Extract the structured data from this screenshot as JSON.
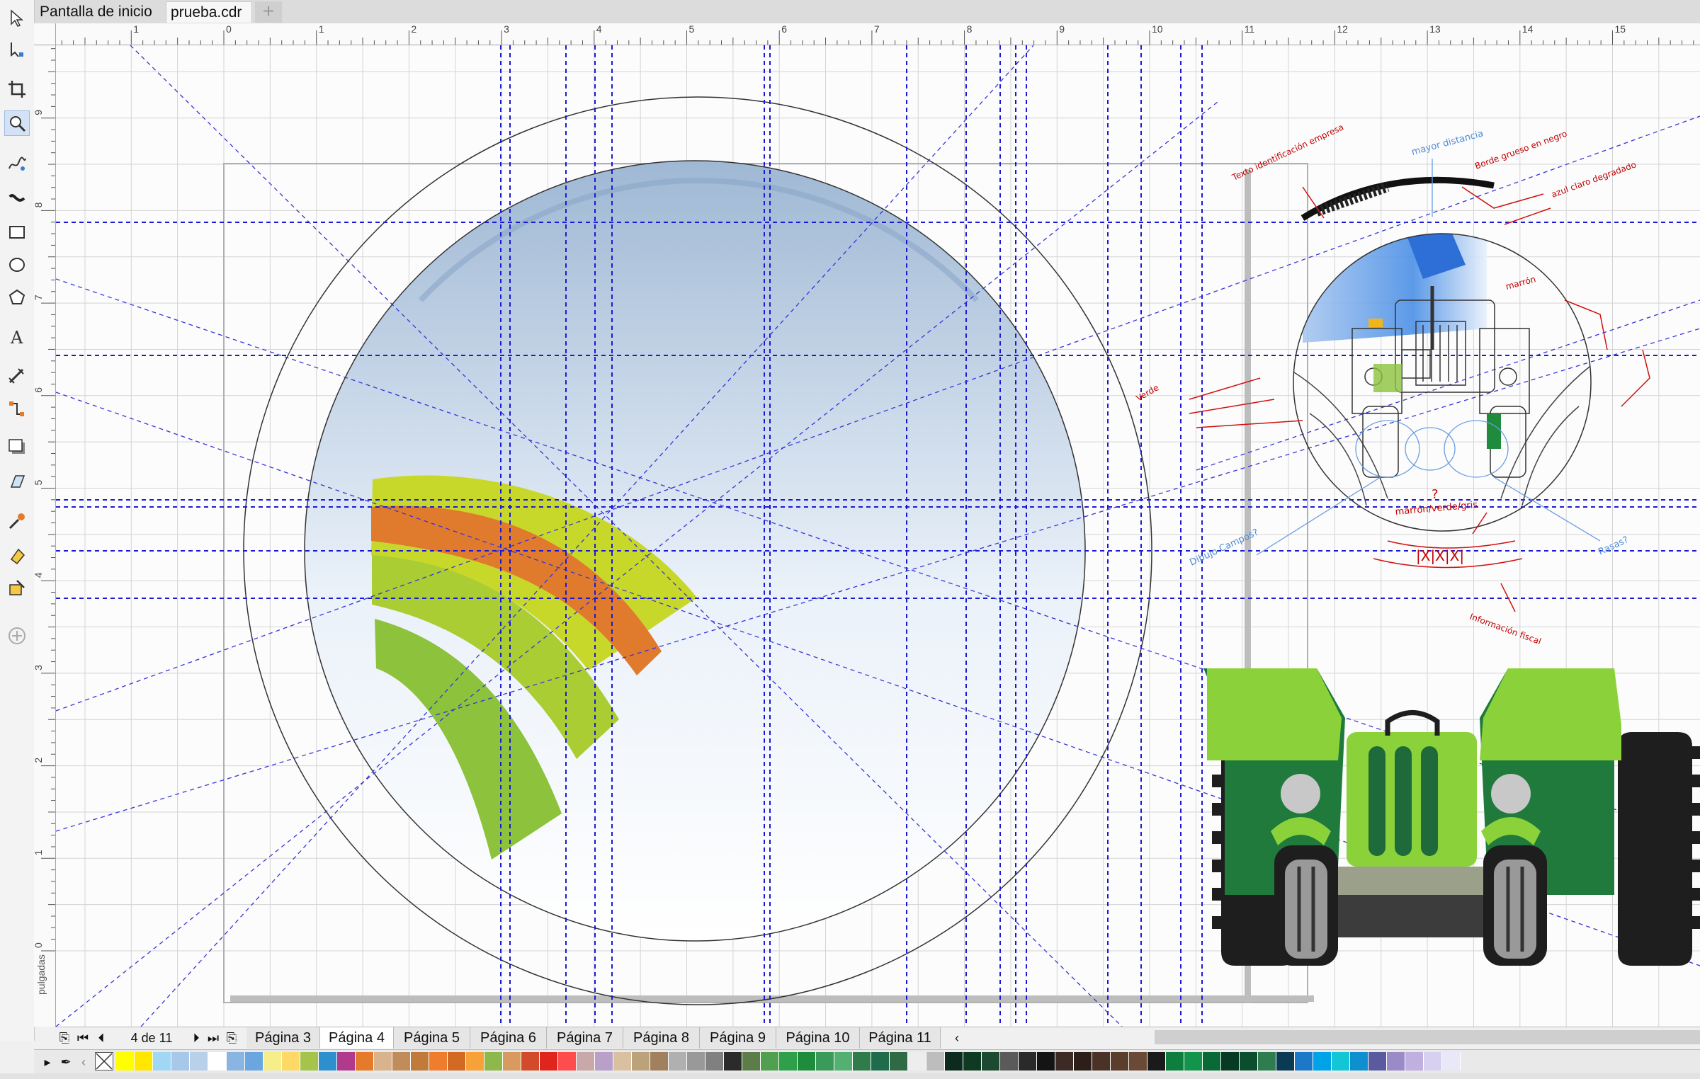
{
  "document_tabs": [
    {
      "label": "Pantalla de inicio",
      "active": false
    },
    {
      "label": "prueba.cdr",
      "active": true
    }
  ],
  "add_tab_icon": "plus-icon",
  "toolbox_icons": [
    "pick-tool-icon",
    "shape-tool-icon",
    "crop-tool-icon",
    "zoom-tool-icon",
    "freehand-tool-icon",
    "artistic-media-icon",
    "rectangle-tool-icon",
    "ellipse-tool-icon",
    "polygon-tool-icon",
    "text-tool-icon",
    "parallel-dimension-icon",
    "connector-tool-icon",
    "drop-shadow-icon",
    "transparency-icon",
    "eyedropper-icon",
    "interactive-fill-icon",
    "smart-fill-icon",
    "add-tool-icon"
  ],
  "ruler": {
    "units_label": "pulgadas",
    "top_ticks": [
      "1",
      "0",
      "1",
      "2",
      "3",
      "4",
      "5",
      "6",
      "7",
      "8",
      "9",
      "10",
      "11",
      "12",
      "13",
      "14",
      "15"
    ],
    "left_ticks": [
      "9",
      "8",
      "7",
      "6",
      "5",
      "4",
      "3",
      "2",
      "1",
      "0"
    ]
  },
  "sketch_notes": {
    "texto": "Texto identificación empresa",
    "distancia": "mayor distancia",
    "borde": "Borde grueso en negro",
    "azul": "azul claro degradado",
    "marron": "marrón",
    "verde": "Verde",
    "colores": "marrón/verde/gris",
    "interrogacion": "?",
    "dibujo": "Dibujo Campos?",
    "rasas": "Rasas?",
    "fiscal_code": "|X|X|X|",
    "informacion": "Información fiscal"
  },
  "page_navigator": {
    "page_counter": "4 de 11",
    "first_icon": "first-page-icon",
    "prev_icon": "previous-page-icon",
    "next_icon": "next-page-icon",
    "last_icon": "last-page-icon",
    "add_before_icon": "add-page-before-icon",
    "add_after_icon": "add-page-after-icon",
    "scroll_left_icon": "scroll-left-icon",
    "pages": [
      {
        "label": "Página 3",
        "active": false
      },
      {
        "label": "Página 4",
        "active": true
      },
      {
        "label": "Página 5",
        "active": false
      },
      {
        "label": "Página 6",
        "active": false
      },
      {
        "label": "Página 7",
        "active": false
      },
      {
        "label": "Página 8",
        "active": false
      },
      {
        "label": "Página 9",
        "active": false
      },
      {
        "label": "Página 10",
        "active": false
      },
      {
        "label": "Página 11",
        "active": false
      }
    ]
  },
  "palette": {
    "no_color_icon": "no-color-icon",
    "eyedropper_icon": "palette-eyedropper-icon",
    "expand_icon": "palette-expand-icon",
    "colors": [
      "#ffff00",
      "#ffe700",
      "#9fd7f5",
      "#a7c8e8",
      "#b8d0ea",
      "#ffffff",
      "#8ab4e1",
      "#6aa6df",
      "#f5ee8a",
      "#ffd966",
      "#a6c34c",
      "#2e8fcf",
      "#b03a8e",
      "#e57a2a",
      "#d9b38c",
      "#bf8c5a",
      "#c07a3a",
      "#ee7e2e",
      "#d26a24",
      "#f7a239",
      "#8fb84a",
      "#d99a60",
      "#d34a2a",
      "#e0261c",
      "#ff4d4d",
      "#c8a8a8",
      "#b8a0c8",
      "#d8c0a0",
      "#bba27a",
      "#a0805e",
      "#b0b0b0",
      "#999999",
      "#808080",
      "#2b2b2b",
      "#5c7c4a",
      "#50a050",
      "#2ea04a",
      "#1e8c3c",
      "#3a9a5a",
      "#54b070",
      "#2f7c4a",
      "#1f6c4c",
      "#306a45",
      "#ededed",
      "#bdbdbd",
      "#0d2a1e",
      "#0f3a22",
      "#1b4a30",
      "#5a5a5a",
      "#2a2a2a",
      "#141414",
      "#3b2b24",
      "#2c1f1a",
      "#4a3326",
      "#5b3d2b",
      "#6a4a36",
      "#1a1a1a",
      "#0e7e3e",
      "#12944a",
      "#0a6a36",
      "#063a22",
      "#0a4e2e",
      "#2e7d4e",
      "#0b3a55",
      "#1e78c8",
      "#00a2e8",
      "#13c6d6",
      "#0e8fd0",
      "#5a5aa0",
      "#9a8ac8",
      "#c0b0e0",
      "#d8d0f0",
      "#e8e8f8"
    ]
  }
}
